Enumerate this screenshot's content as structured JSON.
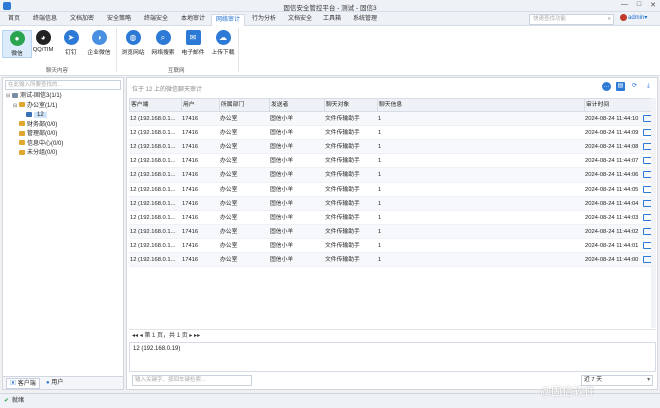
{
  "window": {
    "title": "固信安全管控平台 - 测试 - 固信3",
    "controls": [
      "—",
      "□",
      "✕"
    ]
  },
  "tabs": [
    {
      "label": "首页",
      "active": false
    },
    {
      "label": "终端信息",
      "active": false
    },
    {
      "label": "文档加密",
      "active": false
    },
    {
      "label": "安全策略",
      "active": false
    },
    {
      "label": "终端安全",
      "active": false
    },
    {
      "label": "本地审计",
      "active": false
    },
    {
      "label": "网络审计",
      "active": true
    },
    {
      "label": "行为分析",
      "active": false
    },
    {
      "label": "文档安全",
      "active": false
    },
    {
      "label": "工具箱",
      "active": false
    },
    {
      "label": "系统管理",
      "active": false
    }
  ],
  "search": {
    "placeholder": "快速查找功能",
    "icon": "search-icon"
  },
  "user": {
    "name": "admin",
    "caret": "▾"
  },
  "ribbon": {
    "groups": [
      {
        "label": "聊天内容",
        "buttons": [
          {
            "label": "微信",
            "icon": "wechat-icon",
            "color": "#2aa44f",
            "selected": true
          },
          {
            "label": "QQ/TIM",
            "icon": "qq-icon",
            "color": "#222222",
            "selected": false
          },
          {
            "label": "钉钉",
            "icon": "dingtalk-icon",
            "color": "#2d7ad6",
            "selected": false
          },
          {
            "label": "企业微信",
            "icon": "wecom-icon",
            "color": "#4a90e2",
            "selected": false
          }
        ]
      },
      {
        "label": "互联网",
        "buttons": [
          {
            "label": "浏览网站",
            "icon": "globe-icon",
            "color": "#2d7ad6",
            "selected": false
          },
          {
            "label": "网络搜索",
            "icon": "web-search-icon",
            "color": "#2d7ad6",
            "selected": false
          },
          {
            "label": "电子邮件",
            "icon": "mail-icon",
            "color": "#2d7ad6",
            "selected": false
          },
          {
            "label": "上传下载",
            "icon": "cloud-transfer-icon",
            "color": "#2d7ad6",
            "selected": false
          }
        ]
      }
    ]
  },
  "left": {
    "search_placeholder": "在此输入所要查找的...",
    "tree": [
      {
        "label": "测试-固信3(1/1)",
        "toggle": "⊟",
        "color": "#7a8da6",
        "selected": false
      },
      {
        "label": "办公室(1/1)",
        "toggle": "⊟",
        "color": "#e0a82e",
        "selected": false
      },
      {
        "label": "12",
        "toggle": "",
        "color": "#3a6fb5",
        "selected": true
      },
      {
        "label": "财务部(0/0)",
        "toggle": "",
        "color": "#e0a82e",
        "selected": false
      },
      {
        "label": "管理部(0/0)",
        "toggle": "",
        "color": "#e0a82e",
        "selected": false
      },
      {
        "label": "信息中心(0/0)",
        "toggle": "",
        "color": "#e0a82e",
        "selected": false
      },
      {
        "label": "未分组(0/0)",
        "toggle": "",
        "color": "#e0a82e",
        "selected": false
      }
    ],
    "tabs": [
      {
        "label": "客户端",
        "active": true
      },
      {
        "label": "用户",
        "active": false
      }
    ]
  },
  "main": {
    "caption": "位于 12 上的微信聊天审计",
    "toolbar": [
      "chat-icon",
      "layout-icon",
      "refresh-icon",
      "export-icon"
    ],
    "columns": [
      "客户端",
      "用户",
      "所属部门",
      "发送者",
      "聊天对象",
      "聊天信息",
      "审计时间"
    ],
    "rows": [
      [
        "12 (192.168.0.1...",
        "17416",
        "办公室",
        "固信小羊",
        "文件传输助手",
        "1",
        "2024-08-24 11:44:10"
      ],
      [
        "12 (192.168.0.1...",
        "17416",
        "办公室",
        "固信小羊",
        "文件传输助手",
        "1",
        "2024-08-24 11:44:09"
      ],
      [
        "12 (192.168.0.1...",
        "17416",
        "办公室",
        "固信小羊",
        "文件传输助手",
        "1",
        "2024-08-24 11:44:08"
      ],
      [
        "12 (192.168.0.1...",
        "17416",
        "办公室",
        "固信小羊",
        "文件传输助手",
        "1",
        "2024-08-24 11:44:07"
      ],
      [
        "12 (192.168.0.1...",
        "17416",
        "办公室",
        "固信小羊",
        "文件传输助手",
        "1",
        "2024-08-24 11:44:06"
      ],
      [
        "12 (192.168.0.1...",
        "17416",
        "办公室",
        "固信小羊",
        "文件传输助手",
        "1",
        "2024-08-24 11:44:05"
      ],
      [
        "12 (192.168.0.1...",
        "17416",
        "办公室",
        "固信小羊",
        "文件传输助手",
        "1",
        "2024-08-24 11:44:04"
      ],
      [
        "12 (192.168.0.1...",
        "17416",
        "办公室",
        "固信小羊",
        "文件传输助手",
        "1",
        "2024-08-24 11:44:03"
      ],
      [
        "12 (192.168.0.1...",
        "17416",
        "办公室",
        "固信小羊",
        "文件传输助手",
        "1",
        "2024-08-24 11:44:02"
      ],
      [
        "12 (192.168.0.1...",
        "17416",
        "办公室",
        "固信小羊",
        "文件传输助手",
        "1",
        "2024-08-24 11:44:01"
      ],
      [
        "12 (192.168.0.1...",
        "17416",
        "办公室",
        "固信小羊",
        "文件传输助手",
        "1",
        "2024-08-24 11:44:00"
      ]
    ],
    "pager": "◂◂ ◂ 第 1 页，共 1 页 ▸ ▸▸",
    "detail": "12 (192.168.0.19)",
    "keyword_placeholder": "输入关键字、按回车键检索...",
    "days": "近 7 天"
  },
  "status": {
    "text": "就绪"
  },
  "watermark": "@固信软件"
}
